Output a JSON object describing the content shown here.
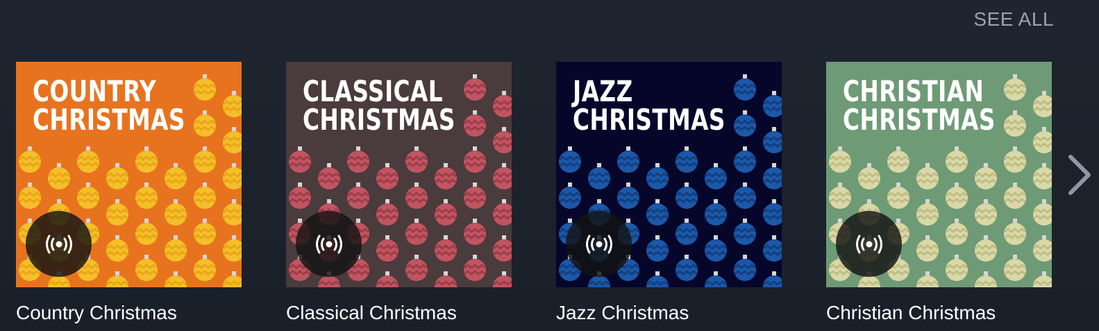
{
  "header": {
    "see_all_label": "SEE ALL"
  },
  "cards": [
    {
      "title_line1": "COUNTRY",
      "title_line2": "CHRISTMAS",
      "label": "Country Christmas",
      "bg_color": "#e8731f",
      "ornament_color": "#f4bf2a",
      "ornament_accent": "#e9a617"
    },
    {
      "title_line1": "CLASSICAL",
      "title_line2": "CHRISTMAS",
      "label": "Classical Christmas",
      "bg_color": "#4a3b3d",
      "ornament_color": "#c05561",
      "ornament_accent": "#9c3d48"
    },
    {
      "title_line1": "JAZZ",
      "title_line2": "CHRISTMAS",
      "label": "Jazz Christmas",
      "bg_color": "#05062a",
      "ornament_color": "#1c58a8",
      "ornament_accent": "#123f80"
    },
    {
      "title_line1": "CHRISTIAN",
      "title_line2": "CHRISTMAS",
      "label": "Christian Christmas",
      "bg_color": "#6e9a76",
      "ornament_color": "#d9d8a6",
      "ornament_accent": "#bfbd86"
    }
  ],
  "icons": {
    "play": "broadcast-icon",
    "next": "chevron-right-icon"
  }
}
